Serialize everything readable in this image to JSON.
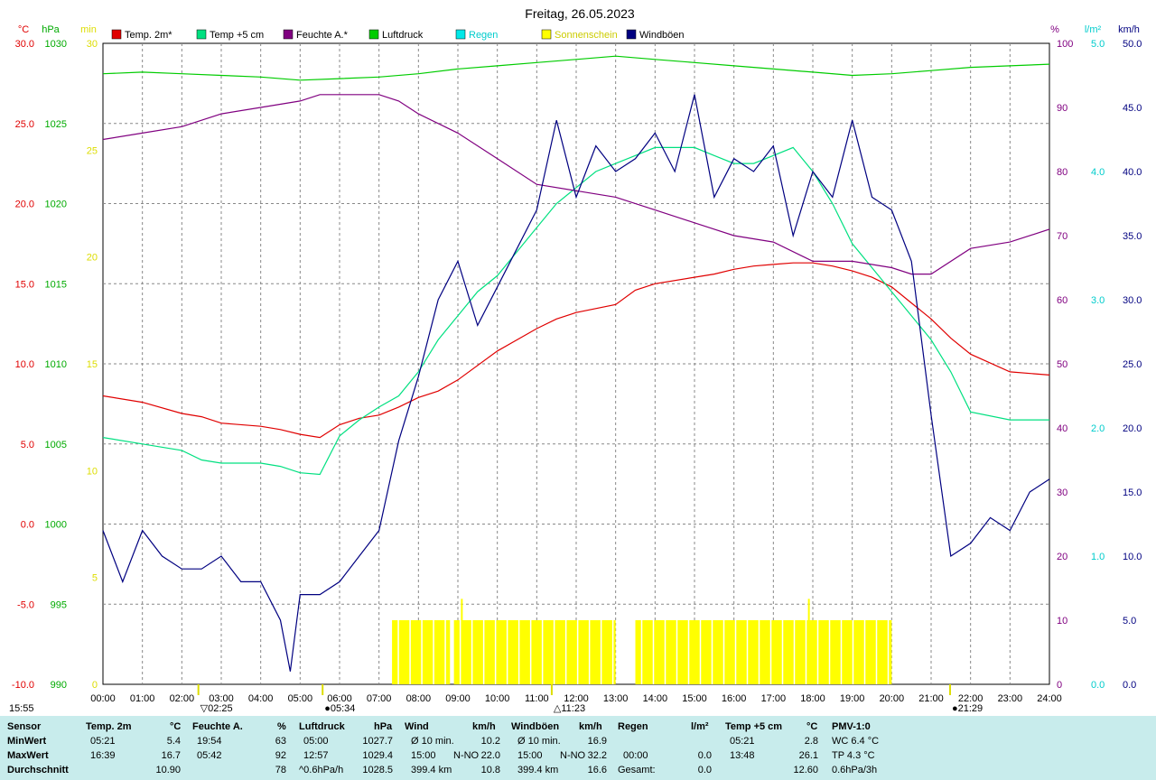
{
  "title": "Freitag, 26.05.2023",
  "colors": {
    "temp2m": "#e00000",
    "temp5cm": "#00e080",
    "humidity": "#800080",
    "pressure": "#00cc00",
    "rain": "#00e8e8",
    "sunshine": "#ffff00",
    "gusts": "#000080",
    "grid": "#888888",
    "background": "#c8ecec"
  },
  "legend": [
    {
      "label": "Temp. 2m*",
      "color": "#e00000"
    },
    {
      "label": "Temp +5 cm",
      "color": "#00e080"
    },
    {
      "label": "Feuchte A.*",
      "color": "#800080"
    },
    {
      "label": "Luftdruck",
      "color": "#00cc00"
    },
    {
      "label": "Regen",
      "color": "#00e8e8"
    },
    {
      "label": "Sonnenschein",
      "color": "#ffff00"
    },
    {
      "label": "Windböen",
      "color": "#000080"
    }
  ],
  "axes": {
    "temp": {
      "unit": "°C",
      "ticks": [
        "30.0",
        "25.0",
        "20.0",
        "15.0",
        "10.0",
        "5.0",
        "0.0",
        "-5.0",
        "-10.0"
      ]
    },
    "pressure": {
      "unit": "hPa",
      "ticks": [
        "1030",
        "1025",
        "1020",
        "1015",
        "1010",
        "1005",
        "1000",
        "995",
        "990"
      ]
    },
    "sun": {
      "unit": "min",
      "ticks": [
        "30",
        "25",
        "20",
        "15",
        "10",
        "5",
        "0"
      ]
    },
    "humidity": {
      "unit": "%",
      "ticks": [
        "100",
        "90",
        "80",
        "70",
        "60",
        "50",
        "40",
        "30",
        "20",
        "10",
        "0"
      ]
    },
    "rain": {
      "unit": "l/m²",
      "ticks": [
        "5.0",
        "4.0",
        "3.0",
        "2.0",
        "1.0",
        "0.0"
      ]
    },
    "wind": {
      "unit": "km/h",
      "ticks": [
        "50.0",
        "45.0",
        "40.0",
        "35.0",
        "30.0",
        "25.0",
        "20.0",
        "15.0",
        "10.0",
        "5.0",
        "0.0"
      ]
    },
    "x": [
      "00:00",
      "01:00",
      "02:00",
      "03:00",
      "04:00",
      "05:00",
      "06:00",
      "07:00",
      "08:00",
      "09:00",
      "10:00",
      "11:00",
      "12:00",
      "13:00",
      "14:00",
      "15:00",
      "16:00",
      "17:00",
      "18:00",
      "19:00",
      "20:00",
      "21:00",
      "22:00",
      "23:00",
      "24:00"
    ]
  },
  "markers": [
    {
      "label": "02:25",
      "hour": 2.42,
      "sym": "▽"
    },
    {
      "label": "05:34",
      "hour": 5.57,
      "sym": "●"
    },
    {
      "label": "11:23",
      "hour": 11.38,
      "sym": "△"
    },
    {
      "label": "21:29",
      "hour": 21.48,
      "sym": "●"
    }
  ],
  "corner_time": "15:55",
  "chart_data": {
    "type": "line",
    "x_unit": "hour",
    "xlim": [
      0,
      24
    ],
    "series": [
      {
        "name": "Temp. 2m*",
        "unit": "°C",
        "ylim": [
          -10,
          30
        ],
        "x": [
          0,
          1,
          2,
          2.5,
          3,
          4,
          4.5,
          5,
          5.5,
          6,
          6.5,
          7,
          7.5,
          8,
          8.5,
          9,
          10,
          11,
          11.5,
          12,
          13,
          13.5,
          14,
          15,
          15.5,
          16,
          16.5,
          17,
          17.5,
          18,
          18.5,
          19,
          19.5,
          20,
          20.5,
          21,
          21.5,
          22,
          23,
          24
        ],
        "y": [
          8.0,
          7.6,
          6.9,
          6.7,
          6.3,
          6.1,
          5.9,
          5.6,
          5.4,
          6.2,
          6.6,
          6.8,
          7.3,
          7.9,
          8.3,
          9.0,
          10.8,
          12.2,
          12.8,
          13.2,
          13.7,
          14.6,
          15.0,
          15.4,
          15.6,
          15.9,
          16.1,
          16.2,
          16.3,
          16.3,
          16.1,
          15.8,
          15.4,
          14.8,
          13.8,
          12.8,
          11.6,
          10.6,
          9.5,
          9.3
        ]
      },
      {
        "name": "Temp +5 cm",
        "unit": "°C",
        "ylim": [
          -10,
          30
        ],
        "x": [
          0,
          1,
          2,
          2.5,
          3,
          4,
          4.5,
          5,
          5.5,
          6,
          6.5,
          7,
          7.5,
          8,
          8.5,
          9,
          9.5,
          10,
          10.5,
          11,
          11.5,
          12,
          12.5,
          13,
          13.5,
          14,
          14.5,
          15,
          15.5,
          16,
          16.5,
          17,
          17.5,
          18,
          18.5,
          19,
          19.5,
          20,
          20.5,
          21,
          21.5,
          22,
          23,
          24
        ],
        "y": [
          5.4,
          5.0,
          4.6,
          4.0,
          3.8,
          3.8,
          3.6,
          3.2,
          3.1,
          5.5,
          6.5,
          7.3,
          8.0,
          9.5,
          11.5,
          13.0,
          14.5,
          15.5,
          17.0,
          18.5,
          20.0,
          21.0,
          22.0,
          22.5,
          23.0,
          23.5,
          23.5,
          23.5,
          23.0,
          22.5,
          22.5,
          23.0,
          23.5,
          22.0,
          20.0,
          17.5,
          16.0,
          14.5,
          13.0,
          11.5,
          9.5,
          7.0,
          6.5,
          6.5
        ]
      },
      {
        "name": "Feuchte A.*",
        "unit": "%",
        "ylim": [
          0,
          100
        ],
        "x": [
          0,
          1,
          2,
          3,
          4,
          5,
          5.5,
          6,
          6.5,
          7,
          7.5,
          8,
          9,
          10,
          11,
          12,
          13,
          14,
          15,
          16,
          17,
          18,
          19,
          20,
          20.5,
          21,
          22,
          23,
          24
        ],
        "y": [
          85,
          86,
          87,
          89,
          90,
          91,
          92,
          92,
          92,
          92,
          91,
          89,
          86,
          82,
          78,
          77,
          76,
          74,
          72,
          70,
          69,
          66,
          66,
          65,
          64,
          64,
          68,
          69,
          71
        ]
      },
      {
        "name": "Luftdruck",
        "unit": "hPa",
        "ylim": [
          990,
          1030
        ],
        "x": [
          0,
          1,
          2,
          3,
          4,
          5,
          6,
          7,
          8,
          9,
          10,
          11,
          12,
          13,
          14,
          15,
          16,
          17,
          18,
          19,
          20,
          21,
          22,
          23,
          24
        ],
        "y": [
          1028.1,
          1028.2,
          1028.1,
          1028.0,
          1027.9,
          1027.7,
          1027.8,
          1027.9,
          1028.1,
          1028.4,
          1028.6,
          1028.8,
          1029.0,
          1029.2,
          1029.0,
          1028.8,
          1028.6,
          1028.4,
          1028.2,
          1028.0,
          1028.1,
          1028.3,
          1028.5,
          1028.6,
          1028.7
        ]
      },
      {
        "name": "Windböen",
        "unit": "km/h",
        "ylim": [
          0,
          50
        ],
        "x": [
          0,
          0.5,
          1,
          1.5,
          2,
          2.5,
          3,
          3.5,
          4,
          4.5,
          4.75,
          5,
          5.5,
          6,
          6.5,
          7,
          7.5,
          8,
          8.5,
          9,
          9.5,
          10,
          10.5,
          11,
          11.5,
          12,
          12.5,
          13,
          13.5,
          14,
          14.5,
          15,
          15.5,
          16,
          16.5,
          17,
          17.5,
          18,
          18.5,
          19,
          19.5,
          20,
          20.5,
          21,
          21.5,
          22,
          22.5,
          23,
          23.5,
          24
        ],
        "y": [
          12,
          8,
          12,
          10,
          9,
          9,
          10,
          8,
          8,
          5,
          1,
          7,
          7,
          8,
          10,
          12,
          19,
          24,
          30,
          33,
          28,
          31,
          34,
          37,
          44,
          38,
          42,
          40,
          41,
          43,
          40,
          46,
          38,
          41,
          40,
          42,
          35,
          40,
          38,
          44,
          38,
          37,
          33,
          21,
          10,
          11,
          13,
          12,
          15,
          16
        ]
      }
    ],
    "sunshine": {
      "name": "Sonnenschein",
      "unit": "min",
      "ylim": [
        0,
        30
      ],
      "intervals": [
        [
          7.33,
          8.8
        ],
        [
          8.9,
          13.0
        ],
        [
          13.5,
          20.0
        ]
      ],
      "value": 3,
      "peaks": [
        {
          "hour": 9.1,
          "value": 4
        },
        {
          "hour": 17.9,
          "value": 4
        }
      ]
    }
  },
  "stats": {
    "headers": [
      "Sensor",
      "Temp. 2m",
      "°C",
      "Feuchte A.",
      "%",
      "Luftdruck",
      "hPa",
      "Wind",
      "km/h",
      "Windböen",
      "km/h",
      "Regen",
      "l/m²",
      "Temp +5 cm",
      "°C",
      "PMV-1:0"
    ],
    "row_labels": [
      "MinWert",
      "MaxWert",
      "Durchschnitt"
    ],
    "temp2m": [
      [
        "05:21",
        "5.4"
      ],
      [
        "16:39",
        "16.7"
      ],
      [
        "",
        "10.90"
      ]
    ],
    "humidity": [
      [
        "19:54",
        "63"
      ],
      [
        "05:42",
        "92"
      ],
      [
        "",
        "78"
      ]
    ],
    "pressure": [
      [
        "05:00",
        "1027.7"
      ],
      [
        "12:57",
        "1029.4"
      ],
      [
        "^0.6hPa/h",
        "1028.5"
      ]
    ],
    "wind": [
      [
        "Ø 10 min.",
        "",
        "10.2"
      ],
      [
        "15:00",
        "N-NO",
        "22.0"
      ],
      [
        "399.4 km",
        "",
        "10.8"
      ]
    ],
    "gusts": [
      [
        "Ø 10 min.",
        "",
        "16.9"
      ],
      [
        "15:00",
        "N-NO",
        "32.2"
      ],
      [
        "399.4 km",
        "",
        "16.6"
      ]
    ],
    "rain": [
      [
        "",
        ""
      ],
      [
        "00:00",
        "0.0"
      ],
      [
        "Gesamt:",
        "0.0"
      ]
    ],
    "temp5cm": [
      [
        "05:21",
        "2.8"
      ],
      [
        "13:48",
        "26.1"
      ],
      [
        "",
        "12.60"
      ]
    ],
    "pmv": [
      "WC 6.4 °C",
      "TP 4.3 °C",
      "0.6hPa/3h"
    ]
  }
}
